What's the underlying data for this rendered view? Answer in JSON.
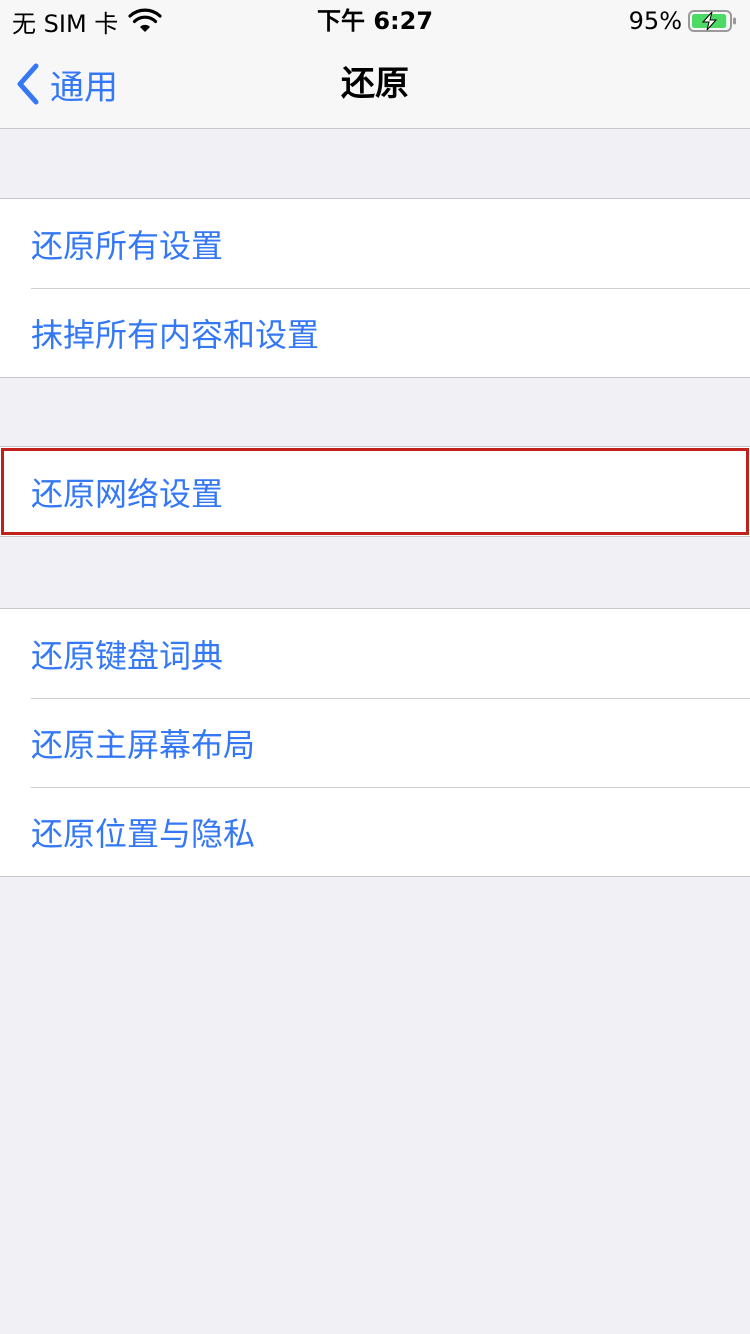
{
  "status_bar": {
    "carrier": "无 SIM 卡",
    "time": "下午 6:27",
    "battery": "95%",
    "battery_percent": 95
  },
  "nav": {
    "back_label": "通用",
    "title": "还原"
  },
  "groups": [
    {
      "items": [
        {
          "label": "还原所有设置"
        },
        {
          "label": "抹掉所有内容和设置"
        }
      ]
    },
    {
      "items": [
        {
          "label": "还原网络设置"
        }
      ]
    },
    {
      "items": [
        {
          "label": "还原键盘词典"
        },
        {
          "label": "还原主屏幕布局"
        },
        {
          "label": "还原位置与隐私"
        }
      ]
    }
  ],
  "colors": {
    "accent": "#3478f6",
    "background": "#f0f0f5",
    "highlight_border": "#c0211a",
    "battery_fill": "#4cd964"
  }
}
